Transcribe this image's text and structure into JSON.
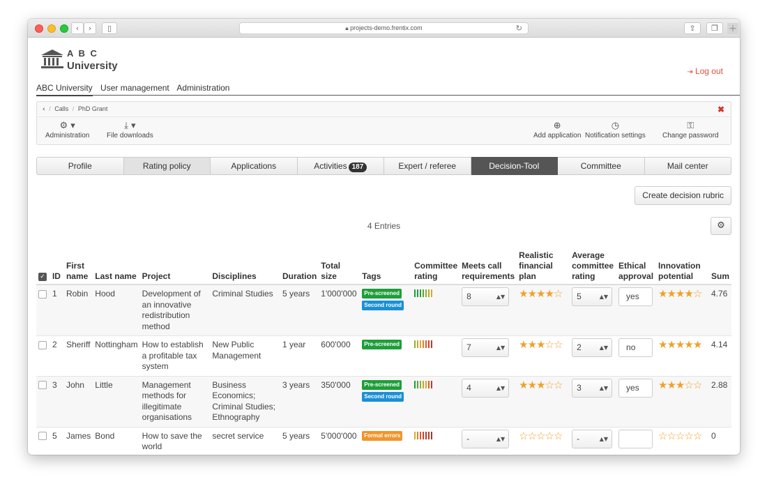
{
  "browser": {
    "url": "projects-demo.frentix.com"
  },
  "logo": {
    "line1": "A B C",
    "line2": "University"
  },
  "logout_label": "Log out",
  "topnav": [
    "ABC University",
    "User management",
    "Administration"
  ],
  "breadcrumb": [
    "Calls",
    "PhD Grant"
  ],
  "toolbar": {
    "administration": "Administration",
    "file_downloads": "File downloads",
    "add_application": "Add application",
    "notification_settings": "Notification settings",
    "change_password": "Change password"
  },
  "tabs": [
    {
      "label": "Profile"
    },
    {
      "label": "Rating policy"
    },
    {
      "label": "Applications"
    },
    {
      "label": "Activities",
      "badge": "187"
    },
    {
      "label": "Expert / referee"
    },
    {
      "label": "Decision-Tool",
      "active": true
    },
    {
      "label": "Committee"
    },
    {
      "label": "Mail center"
    }
  ],
  "create_rubric_label": "Create decision rubric",
  "entries_label": "4 Entries",
  "columns": {
    "id": "ID",
    "first": "First name",
    "last": "Last name",
    "project": "Project",
    "disciplines": "Disciplines",
    "duration": "Duration",
    "total_size": "Total size",
    "tags": "Tags",
    "committee_rating": "Committee rating",
    "meets": "Meets call requirements",
    "financial": "Realistic financial plan",
    "avg_rating": "Average committee rating",
    "ethical": "Ethical approval",
    "innovation": "Innovation potential",
    "sum": "Sum"
  },
  "colors": {
    "star": "#f0a028",
    "green_tag": "#1e9e3a",
    "blue_tag": "#1a8fd6",
    "orange_tag": "#f0952a",
    "active_tab": "#555555",
    "logout": "#e74c3c"
  },
  "rows": [
    {
      "id": "1",
      "first": "Robin",
      "last": "Hood",
      "project": "Development of an innovative redistribution method",
      "disciplines": "Criminal Studies",
      "duration": "5 years",
      "total_size": "1'000'000",
      "tags": [
        {
          "label": "Pre-screened",
          "color": "green"
        },
        {
          "label": "Second round",
          "color": "blue"
        }
      ],
      "committee_bars": [
        "#1e9e3a",
        "#1e9e3a",
        "#1e9e3a",
        "#5aa52c",
        "#8fb12a",
        "#b9a82b",
        "#e0a532"
      ],
      "meets": "8",
      "financial_stars": 4,
      "avg_rating": "5",
      "ethical": "yes",
      "innovation_stars": 4,
      "sum": "4.76"
    },
    {
      "id": "2",
      "first": "Sheriff",
      "last": "Nottingham",
      "project": "How to establish a profitable tax system",
      "disciplines": "New Public Management",
      "duration": "1 year",
      "total_size": "600'000",
      "tags": [
        {
          "label": "Pre-screened",
          "color": "green"
        }
      ],
      "committee_bars": [
        "#8fb12a",
        "#c9a72c",
        "#e0a532",
        "#e67e22",
        "#e05a2b",
        "#d83a2a",
        "#c0392b"
      ],
      "meets": "7",
      "financial_stars": 3,
      "avg_rating": "2",
      "ethical": "no",
      "innovation_stars": 5,
      "sum": "4.14"
    },
    {
      "id": "3",
      "first": "John",
      "last": "Little",
      "project": "Management methods for illegitimate organisations",
      "disciplines": "Business Economics; Criminal Studies; Ethnography",
      "duration": "3 years",
      "total_size": "350'000",
      "tags": [
        {
          "label": "Pre-screened",
          "color": "green"
        },
        {
          "label": "Second round",
          "color": "blue"
        }
      ],
      "committee_bars": [
        "#1e9e3a",
        "#5aa52c",
        "#8fb12a",
        "#c9a72c",
        "#e0a532",
        "#e05a2b",
        "#c0392b"
      ],
      "meets": "4",
      "financial_stars": 3,
      "avg_rating": "3",
      "ethical": "yes",
      "innovation_stars": 3,
      "sum": "2.88"
    },
    {
      "id": "5",
      "first": "James",
      "last": "Bond",
      "project": "How to save the world",
      "disciplines": "secret service",
      "duration": "5 years",
      "total_size": "5'000'000",
      "tags": [
        {
          "label": "Formal errors",
          "color": "orange"
        }
      ],
      "committee_bars": [
        "#e0a532",
        "#e67e22",
        "#e05a2b",
        "#d83a2a",
        "#c0392b",
        "#c0392b",
        "#b03025"
      ],
      "meets": "-",
      "financial_stars": 0,
      "avg_rating": "-",
      "ethical": "",
      "innovation_stars": 0,
      "sum": "0"
    }
  ]
}
